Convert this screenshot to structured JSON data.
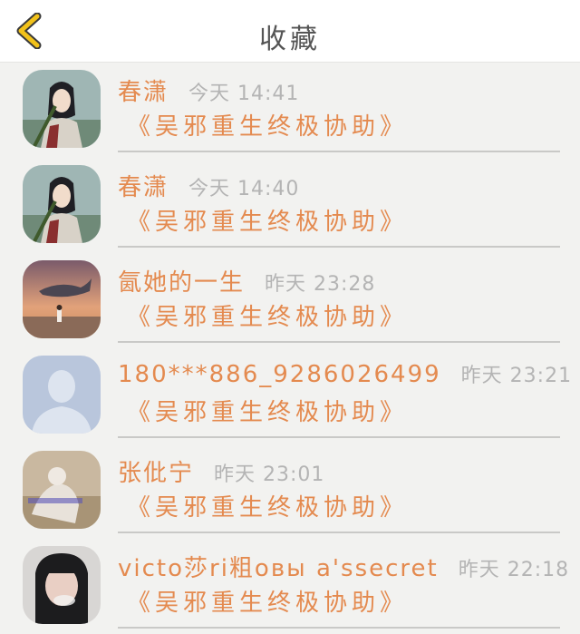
{
  "header": {
    "title": "收藏",
    "back_icon": "chevron-left-icon",
    "accent_color": "#f2c21a"
  },
  "colors": {
    "name": "#e48a4f",
    "time": "#b4b4b4",
    "background": "#f2f2f0"
  },
  "favorites": [
    {
      "name": "春潇",
      "time": "今天 14:41",
      "message": "《吴邪重生终极协助》",
      "avatar": "anime-character-avatar"
    },
    {
      "name": "春潇",
      "time": "今天 14:40",
      "message": "《吴邪重生终极协助》",
      "avatar": "anime-character-avatar"
    },
    {
      "name": "氤她的一生",
      "time": "昨天 23:28",
      "message": "《吴邪重生终极协助》",
      "avatar": "sunset-whale-avatar"
    },
    {
      "name": "180***886_9286026499",
      "time": "昨天 23:21",
      "message": "《吴邪重生终极协助》",
      "avatar": "default-person-avatar"
    },
    {
      "name": "张仳宁",
      "time": "昨天 23:01",
      "message": "《吴邪重生终极协助》",
      "avatar": "photo-person-avatar"
    },
    {
      "name": "victo莎ri粗овы a'ssecret",
      "time": "昨天 22:18",
      "message": "《吴邪重生终极协助》",
      "avatar": "portrait-photo-avatar"
    }
  ]
}
